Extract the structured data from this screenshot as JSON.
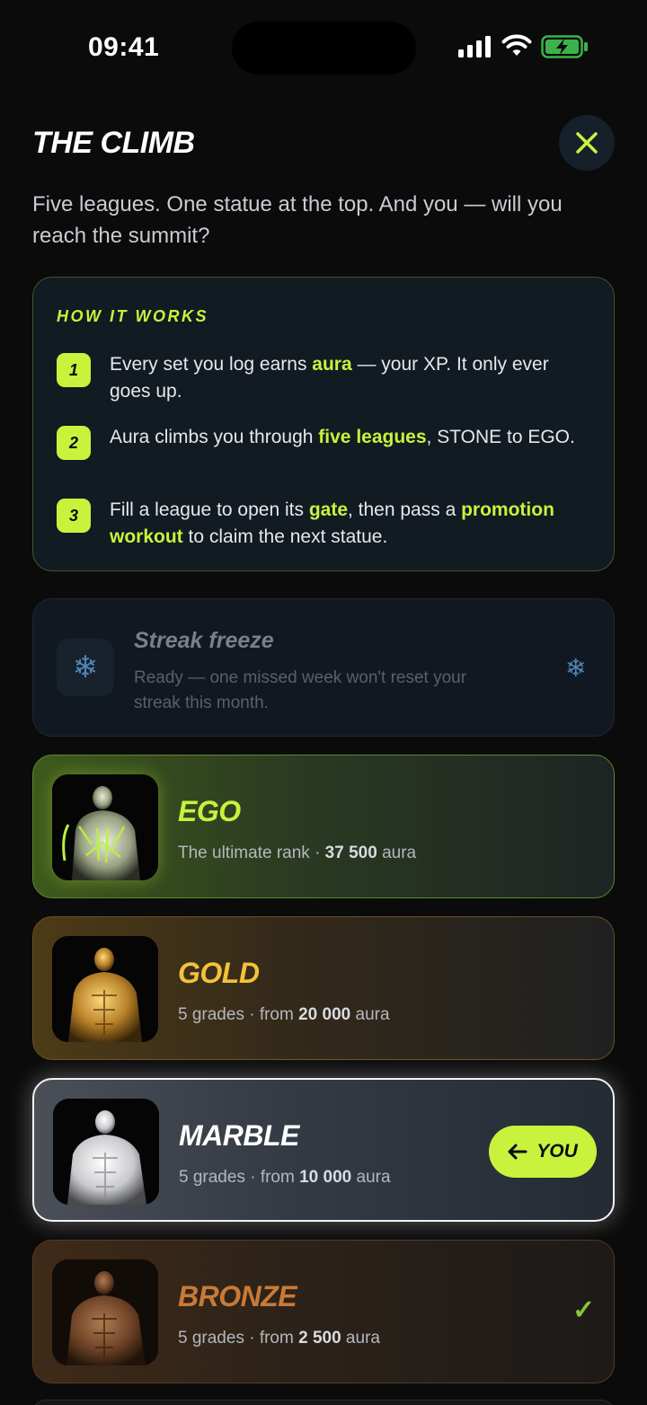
{
  "status_bar": {
    "time": "09:41"
  },
  "header": {
    "title": "THE CLIMB",
    "subtitle": "Five leagues. One statue at the top. And you — will you reach the summit?"
  },
  "how_it_works": {
    "title": "HOW IT WORKS",
    "steps": [
      {
        "num": "1",
        "parts": [
          "Every set you log earns ",
          "aura",
          " — your XP. It only ever goes up."
        ]
      },
      {
        "num": "2",
        "parts": [
          "Aura climbs you through ",
          "five leagues",
          ", STONE to EGO."
        ]
      },
      {
        "num": "3",
        "parts": [
          "Fill a league to open its ",
          "gate",
          ", then pass a ",
          "promotion workout",
          " to claim the next statue."
        ]
      }
    ]
  },
  "streak_freeze": {
    "title": "Streak freeze",
    "description": "Ready — one missed week won't reset your streak this month.",
    "icon": "snowflake-icon"
  },
  "leagues": [
    {
      "name": "EGO",
      "meta_prefix": "The ultimate rank · ",
      "meta_value": "37 500",
      "meta_suffix": " aura",
      "color": "#c8f23c"
    },
    {
      "name": "GOLD",
      "meta_prefix": "5 grades · from ",
      "meta_value": "20 000",
      "meta_suffix": " aura",
      "color": "#f2c23a"
    },
    {
      "name": "MARBLE",
      "meta_prefix": "5 grades · from ",
      "meta_value": "10 000",
      "meta_suffix": " aura",
      "color": "#ffffff",
      "you_label": "YOU"
    },
    {
      "name": "BRONZE",
      "meta_prefix": "5 grades · from ",
      "meta_value": "2 500",
      "meta_suffix": " aura",
      "color": "#c97a37",
      "completed": true
    }
  ],
  "accent": "#c8f23c"
}
